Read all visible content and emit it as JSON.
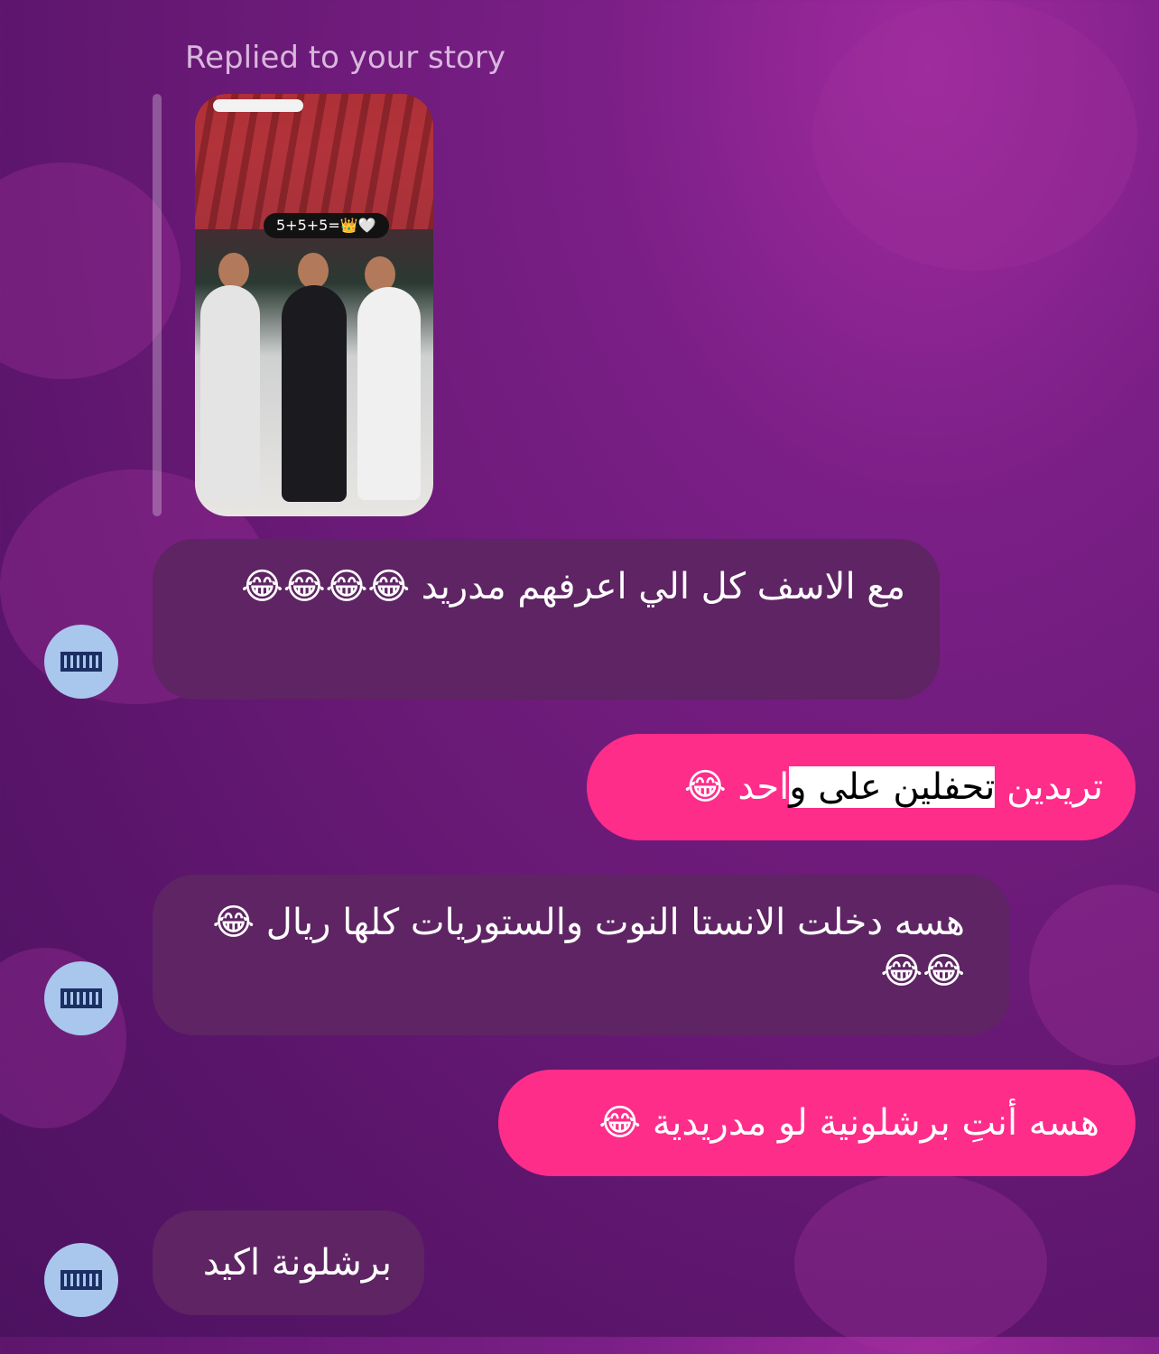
{
  "reply": {
    "caption": "Replied to your story",
    "story_sticker": "5+5+5=👑🤍"
  },
  "messages": [
    {
      "side": "in",
      "text": "مع الاسف كل الي اعرفهم مدريد 😂😂😂😂"
    },
    {
      "side": "out",
      "text_before": "تريدين ",
      "text_highlight": "تحفلين على و",
      "text_after": "احد 😂"
    },
    {
      "side": "in",
      "text": "هسه دخلت الانستا النوت والستوريات كلها ريال 😂😂😂"
    },
    {
      "side": "out",
      "text": "هسه أنتِ برشلونية لو مدريدية 😂"
    },
    {
      "side": "in",
      "text": "برشلونة اكيد"
    }
  ],
  "colors": {
    "incoming_bubble": "#5e2463",
    "outgoing_bubble": "#fe2d8a",
    "avatar_bg": "#a9c6ec"
  }
}
